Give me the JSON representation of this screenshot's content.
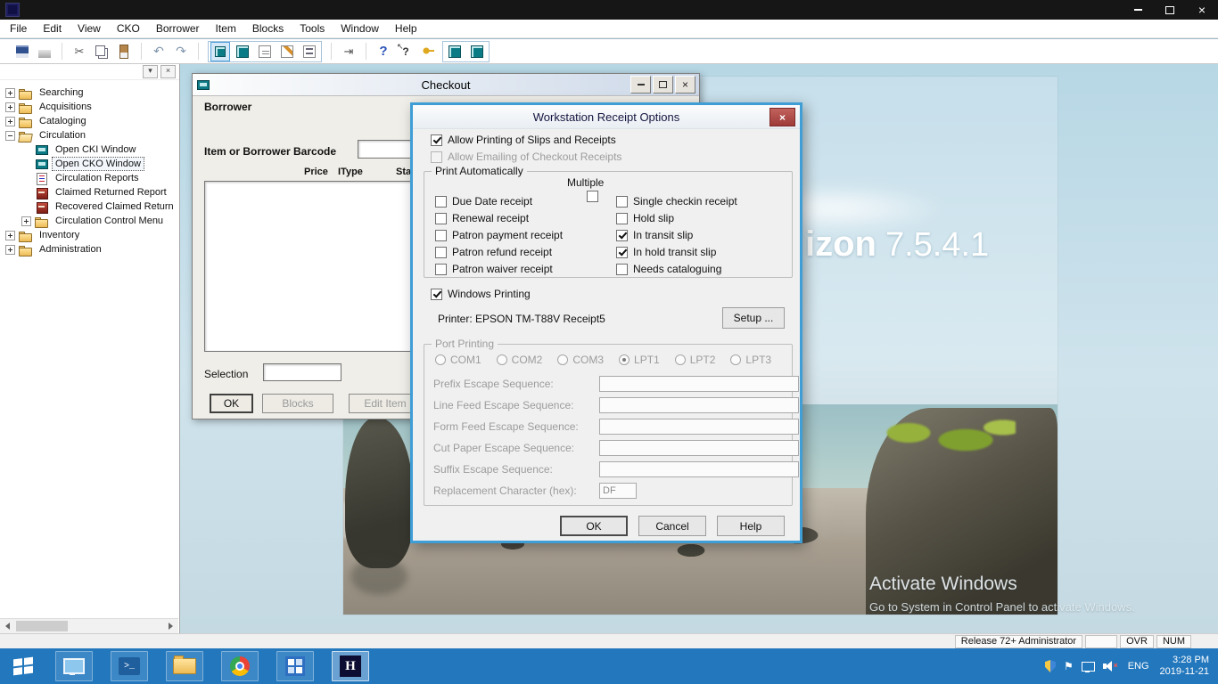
{
  "menubar": {
    "items": [
      "File",
      "Edit",
      "View",
      "CKO",
      "Borrower",
      "Item",
      "Blocks",
      "Tools",
      "Window",
      "Help"
    ]
  },
  "toolbar": {
    "icons": [
      "save-icon",
      "print-icon",
      "cut-icon",
      "copy-icon",
      "paste-icon",
      "undo-icon",
      "redo-icon",
      "checkout-icon",
      "checkin-icon",
      "renew-icon",
      "edit-icon",
      "list-icon",
      "exit-icon",
      "help-icon",
      "context-help-icon",
      "key-icon",
      "monitor-icon-a",
      "monitor-icon-b"
    ]
  },
  "nav": {
    "items": [
      {
        "label": "Searching",
        "icon": "folder",
        "exp": "plus",
        "selected": false
      },
      {
        "label": "Acquisitions",
        "icon": "folder",
        "exp": "plus",
        "selected": false
      },
      {
        "label": "Cataloging",
        "icon": "folder",
        "exp": "plus",
        "selected": false
      },
      {
        "label": "Circulation",
        "icon": "folder-open",
        "exp": "minus",
        "selected": false
      },
      {
        "label": "Open CKI Window",
        "icon": "monitor",
        "exp": "none",
        "selected": false
      },
      {
        "label": "Open CKO Window",
        "icon": "monitor",
        "exp": "none",
        "selected": true
      },
      {
        "label": "Circulation Reports",
        "icon": "report",
        "exp": "none",
        "selected": false
      },
      {
        "label": "Claimed Returned Report",
        "icon": "redbook",
        "exp": "none",
        "selected": false
      },
      {
        "label": "Recovered Claimed Return",
        "icon": "redbook",
        "exp": "none",
        "selected": false
      },
      {
        "label": "Circulation Control Menu",
        "icon": "folder",
        "exp": "plus",
        "selected": false
      },
      {
        "label": "Inventory",
        "icon": "folder",
        "exp": "plus",
        "selected": false
      },
      {
        "label": "Administration",
        "icon": "folder",
        "exp": "plus",
        "selected": false
      }
    ]
  },
  "branding": {
    "text": "izon",
    "version": "7.5.4.1"
  },
  "watermark": {
    "line1": "Activate Windows",
    "line2": "Go to System in Control Panel to activate Windows."
  },
  "checkout": {
    "title": "Checkout",
    "borrower_label": "Borrower",
    "barcode_label": "Item or Borrower Barcode",
    "barcode_value": "",
    "columns": [
      "Price",
      "IType",
      "Sta"
    ],
    "selection_label": "Selection",
    "selection_value": "",
    "buttons": {
      "ok": "OK",
      "blocks": "Blocks",
      "edit_item": "Edit Item"
    }
  },
  "receipt_dialog": {
    "title": "Workstation Receipt Options",
    "allow_printing": {
      "label": "Allow Printing of Slips and Receipts",
      "checked": true
    },
    "allow_emailing": {
      "label": "Allow Emailing of Checkout Receipts",
      "checked": false
    },
    "print_group": {
      "legend": "Print Automatically",
      "multiple_label": "Multiple",
      "multiple_checked": false,
      "left": [
        {
          "label": "Due Date receipt",
          "checked": false
        },
        {
          "label": "Renewal receipt",
          "checked": false
        },
        {
          "label": "Patron payment receipt",
          "checked": false
        },
        {
          "label": "Patron refund receipt",
          "checked": false
        },
        {
          "label": "Patron waiver receipt",
          "checked": false
        }
      ],
      "right": [
        {
          "label": "Single checkin receipt",
          "checked": false
        },
        {
          "label": "Hold slip",
          "checked": false
        },
        {
          "label": "In transit slip",
          "checked": true
        },
        {
          "label": "In hold transit slip",
          "checked": true
        },
        {
          "label": "Needs cataloguing",
          "checked": false
        }
      ]
    },
    "windows_printing": {
      "label": "Windows Printing",
      "checked": true
    },
    "printer_line": "Printer: EPSON TM-T88V Receipt5",
    "setup_button": "Setup ...",
    "port_group": {
      "legend": "Port Printing",
      "ports": [
        {
          "label": "COM1",
          "selected": false
        },
        {
          "label": "COM2",
          "selected": false
        },
        {
          "label": "COM3",
          "selected": false
        },
        {
          "label": "LPT1",
          "selected": true
        },
        {
          "label": "LPT2",
          "selected": false
        },
        {
          "label": "LPT3",
          "selected": false
        }
      ],
      "fields": [
        {
          "label": "Prefix Escape Sequence:",
          "value": ""
        },
        {
          "label": "Line Feed Escape Sequence:",
          "value": ""
        },
        {
          "label": "Form Feed Escape Sequence:",
          "value": ""
        },
        {
          "label": "Cut Paper Escape Sequence:",
          "value": ""
        },
        {
          "label": "Suffix Escape Sequence:",
          "value": ""
        },
        {
          "label": "Replacement Character (hex):",
          "value": "DF"
        }
      ]
    },
    "buttons": {
      "ok": "OK",
      "cancel": "Cancel",
      "help": "Help"
    }
  },
  "statusbar": {
    "release": "Release 72+ Administrator",
    "ovr": "OVR",
    "num": "NUM"
  },
  "taskbar": {
    "apps": [
      {
        "name": "computer"
      },
      {
        "name": "powershell"
      },
      {
        "name": "file-explorer"
      },
      {
        "name": "chrome"
      },
      {
        "name": "app-grid"
      },
      {
        "name": "horizon",
        "letter": "H",
        "active": true
      }
    ],
    "tray": {
      "language": "ENG",
      "time": "3:28 PM",
      "date": "2019-11-21"
    }
  }
}
